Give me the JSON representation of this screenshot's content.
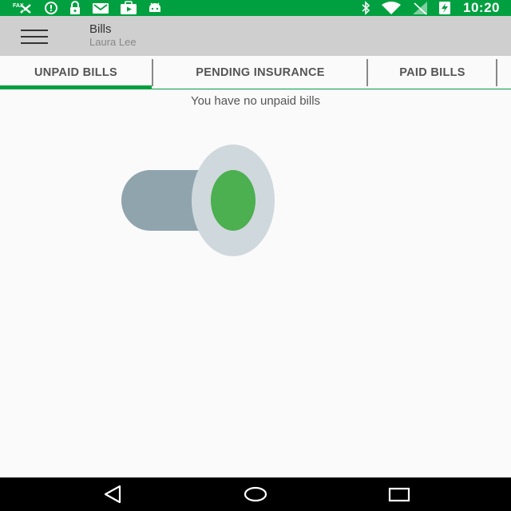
{
  "status_bar": {
    "time": "10:20",
    "left_icons": [
      "fax-icon",
      "sync-icon",
      "lock-icon",
      "mail-icon",
      "media-icon",
      "android-icon"
    ],
    "right_icons": [
      "bluetooth-icon",
      "wifi-icon",
      "signal-icon",
      "battery-charging-icon"
    ],
    "background": "#00a040"
  },
  "app_bar": {
    "title": "Bills",
    "subtitle": "Laura Lee",
    "menu_icon": "hamburger-icon",
    "background": "#cfcfcf"
  },
  "tabs": [
    {
      "label": "UNPAID BILLS",
      "selected": true
    },
    {
      "label": "PENDING INSURANCE",
      "selected": false
    },
    {
      "label": "PAID BILLS",
      "selected": false
    }
  ],
  "content": {
    "empty_message": "You have no unpaid bills",
    "illustration": "empty-bills-illustration"
  },
  "nav_bar": {
    "buttons": [
      "back-icon",
      "home-icon",
      "recent-apps-icon"
    ]
  },
  "colors": {
    "accent": "#00a040",
    "illustration_tube": "#90a4ae",
    "illustration_rim": "#cfd8dc",
    "illustration_center": "#4caf50"
  }
}
